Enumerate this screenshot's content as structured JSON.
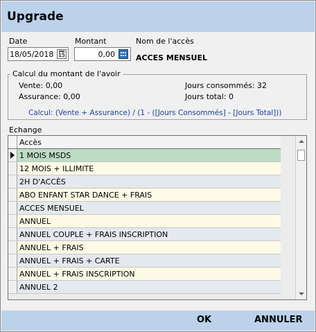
{
  "window": {
    "title": "Upgrade"
  },
  "form": {
    "date_label": "Date",
    "date_value": "18/05/2018",
    "montant_label": "Montant",
    "montant_value": "0,00",
    "nom_acces_label": "Nom de l'accès",
    "nom_acces_value": "ACCES MENSUEL"
  },
  "calcul": {
    "title": "Calcul du montant de l'avoir",
    "vente": "Vente: 0,00",
    "assurance": "Assurance: 0,00",
    "jours_consommes": "Jours consommés: 32",
    "jours_total": "Jours total: 0",
    "formula": "Calcul: (Vente + Assurance) / (1 - ([Jours Consommés] - [Jours Total]))"
  },
  "echange": {
    "label": "Echange",
    "column_header": "Accès",
    "rows": [
      "1 MOIS MSDS",
      "12 MOIS + ILLIMITE",
      "2H D'ACCÈS",
      "ABO ENFANT STAR DANCE + FRAIS",
      "ACCES MENSUEL",
      "ANNUEL",
      "ANNUEL  COUPLE + FRAIS INSCRIPTION",
      "ANNUEL + FRAIS",
      "ANNUEL + FRAIS + CARTE",
      "ANNUEL + FRAIS INSCRIPTION",
      "ANNUEL 2"
    ]
  },
  "footer": {
    "ok_label": "OK",
    "cancel_label": "ANNULER"
  },
  "icons": {
    "calendar": "calendar-icon",
    "calculator": "calculator-icon"
  },
  "colors": {
    "titlebar": "#bcd2ea",
    "selected_row": "#bcdcc4",
    "row_odd": "#fdfbe6",
    "row_even": "#e4e9ee",
    "formula_text": "#1c3fa8"
  }
}
